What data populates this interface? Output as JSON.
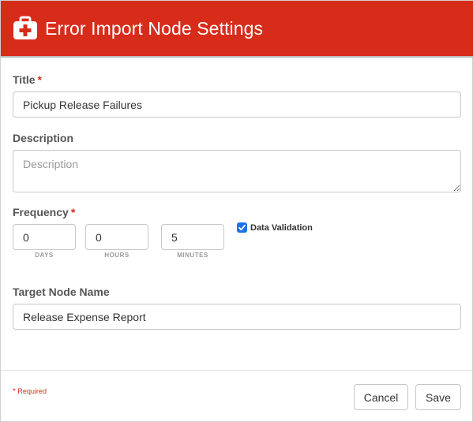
{
  "dialog": {
    "title": "Error Import Node Settings",
    "header_color": "#d82c1a",
    "icon": "first-aid-kit-icon"
  },
  "form": {
    "title_label": "Title",
    "title_value": "Pickup Release Failures",
    "description_label": "Description",
    "description_placeholder": "Description",
    "description_value": "",
    "frequency_label": "Frequency",
    "frequency": {
      "days": "0",
      "hours": "0",
      "minutes": "5",
      "days_caption": "DAYS",
      "hours_caption": "HOURS",
      "minutes_caption": "MINUTES"
    },
    "data_validation_label": "Data Validation",
    "data_validation_checked": true,
    "target_node_label": "Target Node Name",
    "target_node_value": "Release Expense Report",
    "required_marker": "*"
  },
  "footer": {
    "required_note": "Required",
    "cancel_label": "Cancel",
    "save_label": "Save"
  }
}
